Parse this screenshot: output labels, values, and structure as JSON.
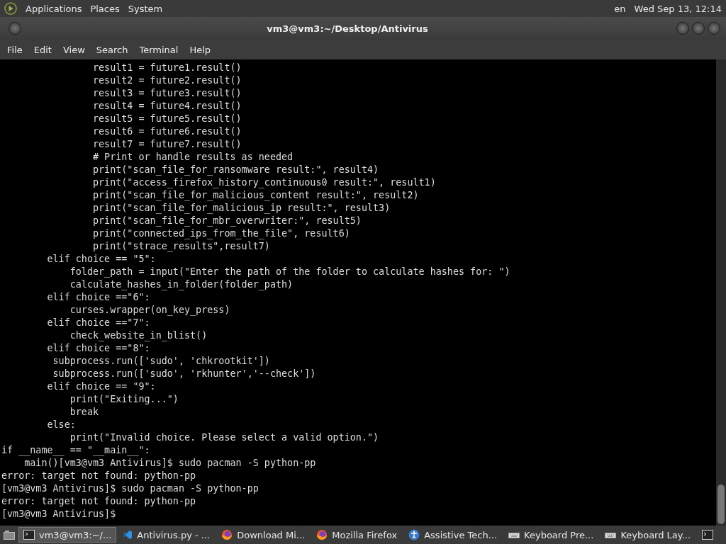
{
  "top_panel": {
    "menus": [
      "Applications",
      "Places",
      "System"
    ],
    "keyboard_layout": "en",
    "clock": "Wed Sep 13, 12:14"
  },
  "window": {
    "title": "vm3@vm3:~/Desktop/Antivirus"
  },
  "menu_bar": [
    "File",
    "Edit",
    "View",
    "Search",
    "Terminal",
    "Help"
  ],
  "terminal_lines": [
    "                result1 = future1.result()",
    "                result2 = future2.result()",
    "                result3 = future3.result()",
    "                result4 = future4.result()",
    "                result5 = future5.result()",
    "                result6 = future6.result()",
    "                result7 = future7.result()",
    "                # Print or handle results as needed",
    "                print(\"scan_file_for_ransomware result:\", result4)",
    "                print(\"access_firefox_history_continuous0 result:\", result1)",
    "                print(\"scan_file_for_malicious_content result:\", result2)",
    "                print(\"scan_file_for_malicious_ip result:\", result3)",
    "                print(\"scan_file_for_mbr_overwriter:\", result5)",
    "                print(\"connected_ips_from_the_file\", result6)",
    "                print(\"strace_results\",result7)",
    "        elif choice == \"5\":",
    "            folder_path = input(\"Enter the path of the folder to calculate hashes for: \")",
    "            calculate_hashes_in_folder(folder_path)",
    "        elif choice ==\"6\":",
    "            curses.wrapper(on_key_press)",
    "        elif choice ==\"7\":",
    "            check_website_in_blist()",
    "        elif choice ==\"8\":",
    "         subprocess.run(['sudo', 'chkrootkit'])",
    "         subprocess.run(['sudo', 'rkhunter','--check'])",
    "        elif choice == \"9\":",
    "            print(\"Exiting...\")",
    "            break",
    "        else:",
    "            print(\"Invalid choice. Please select a valid option.\")",
    "if __name__ == \"__main__\":",
    "    main()[vm3@vm3 Antivirus]$ sudo pacman -S python-pp",
    "error: target not found: python-pp",
    "[vm3@vm3 Antivirus]$ sudo pacman -S python-pp",
    "error: target not found: python-pp",
    "[vm3@vm3 Antivirus]$ "
  ],
  "taskbar": [
    {
      "kind": "terminal",
      "label": "vm3@vm3:~/...",
      "selected": true
    },
    {
      "kind": "editor",
      "label": "Antivirus.py - ...",
      "selected": false
    },
    {
      "kind": "browser",
      "label": "Download Mi...",
      "selected": false
    },
    {
      "kind": "browser",
      "label": "Mozilla Firefox",
      "selected": false
    },
    {
      "kind": "accessibility",
      "label": "Assistive Tech...",
      "selected": false
    },
    {
      "kind": "keyboard",
      "label": "Keyboard Pre...",
      "selected": false
    },
    {
      "kind": "keyboard",
      "label": "Keyboard Lay...",
      "selected": false
    },
    {
      "kind": "terminal",
      "selected": false
    }
  ]
}
